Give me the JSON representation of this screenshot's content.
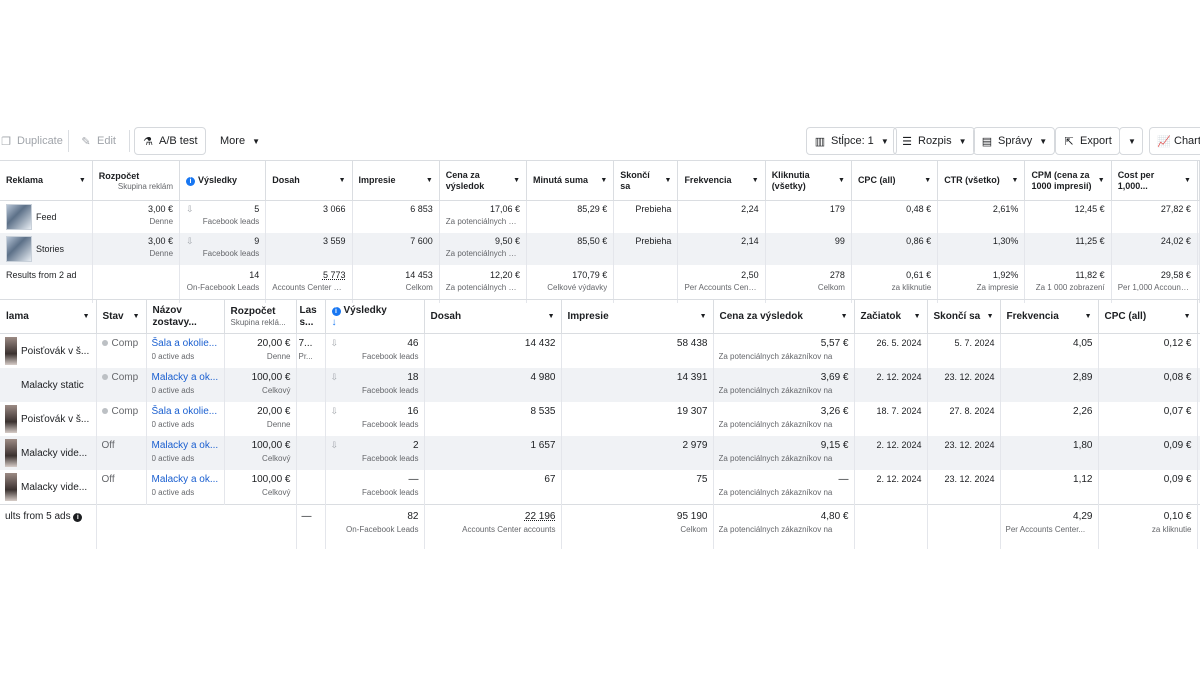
{
  "toolbar": {
    "duplicate": "Duplicate",
    "edit": "Edit",
    "ab_test": "A/B test",
    "more": "More",
    "columns": "Stĺpce: 1",
    "breakdown": "Rozpis",
    "reports": "Správy",
    "export": "Export",
    "charts": "Charts"
  },
  "top_table": {
    "headers": {
      "ad": "Reklama",
      "budget": "Rozpočet",
      "budget_sub": "Skupina reklám",
      "results": "Výsledky",
      "reach": "Dosah",
      "impressions": "Impresie",
      "cost_per_result": "Cena za výsledok",
      "amount_spent": "Minutá suma",
      "ends": "Skončí sa",
      "frequency": "Frekvencia",
      "clicks": "Kliknutia (všetky)",
      "cpc": "CPC (all)",
      "ctr": "CTR (všetko)",
      "cpm": "CPM (cena za 1000 impresií)",
      "cost_per": "Cost per 1,000..."
    },
    "rows": [
      {
        "name": "Feed",
        "budget": "3,00 €",
        "budget_sub": "Denne",
        "results": "5",
        "results_sub": "Facebook leads",
        "reach": "3 066",
        "impressions": "6 853",
        "cost_per_result": "17,06 €",
        "cost_sub": "Za potenciálnych zá...",
        "spent": "85,29 €",
        "ends": "Prebieha",
        "frequency": "2,24",
        "clicks": "179",
        "cpc": "0,48 €",
        "ctr": "2,61%",
        "cpm": "12,45 €",
        "cost_per": "27,82 €"
      },
      {
        "name": "Stories",
        "budget": "3,00 €",
        "budget_sub": "Denne",
        "results": "9",
        "results_sub": "Facebook leads",
        "reach": "3 559",
        "impressions": "7 600",
        "cost_per_result": "9,50 €",
        "cost_sub": "Za potenciálnych zá...",
        "spent": "85,50 €",
        "ends": "Prebieha",
        "frequency": "2,14",
        "clicks": "99",
        "cpc": "0,86 €",
        "ctr": "1,30%",
        "cpm": "11,25 €",
        "cost_per": "24,02 €"
      }
    ],
    "total": {
      "label": "Results from 2 ad",
      "results": "14",
      "results_sub": "On-Facebook Leads",
      "reach": "5 773",
      "reach_sub": "Accounts Center acc...",
      "impressions": "14 453",
      "impressions_sub": "Celkom",
      "cost_per_result": "12,20 €",
      "cost_sub": "Za potenciálnych zá...",
      "spent": "170,79 €",
      "spent_sub": "Celkové výdavky",
      "frequency": "2,50",
      "frequency_sub": "Per Accounts Center...",
      "clicks": "278",
      "clicks_sub": "Celkom",
      "cpc": "0,61 €",
      "cpc_sub": "za kliknutie",
      "ctr": "1,92%",
      "ctr_sub": "Za impresie",
      "cpm": "11,82 €",
      "cpm_sub": "Za 1 000 zobrazení",
      "cost_per": "29,58 €",
      "cost_per_sub": "Per 1,000 Accounts..."
    }
  },
  "bottom_table": {
    "headers": {
      "ad": "lama",
      "status": "Stav",
      "adset": "Názov zostavy...",
      "budget": "Rozpočet",
      "budget_sub": "Skupina reklá...",
      "last": "Las s...",
      "results": "Výsledky",
      "sort_arrow": "↓",
      "reach": "Dosah",
      "impressions": "Impresie",
      "cost_per_result": "Cena za výsledok",
      "start": "Začiatok",
      "ends": "Skončí sa",
      "frequency": "Frekvencia",
      "cpc": "CPC (all)"
    },
    "rows": [
      {
        "name": "Poisťovák v š...",
        "status": "Comp",
        "adset": "Šala a okolie...",
        "adset_sub": "0 active ads",
        "budget": "20,00 €",
        "budget_sub": "Denne",
        "last": "7...",
        "last_sub": "Pr...",
        "results": "46",
        "results_sub": "Facebook leads",
        "reach": "14 432",
        "impressions": "58 438",
        "cost_per_result": "5,57 €",
        "cost_sub": "Za potenciálnych zákazníkov na",
        "start": "26. 5. 2024",
        "ends": "5. 7. 2024",
        "frequency": "4,05",
        "cpc": "0,12 €"
      },
      {
        "name": "Malacky static",
        "status": "Comp",
        "adset": "Malacky a ok...",
        "adset_sub": "0 active ads",
        "budget": "100,00 €",
        "budget_sub": "Celkový",
        "last": "",
        "last_sub": "",
        "results": "18",
        "results_sub": "Facebook leads",
        "reach": "4 980",
        "impressions": "14 391",
        "cost_per_result": "3,69 €",
        "cost_sub": "Za potenciálnych zákazníkov na",
        "start": "2. 12. 2024",
        "ends": "23. 12. 2024",
        "frequency": "2,89",
        "cpc": "0,08 €"
      },
      {
        "name": "Poisťovák v š...",
        "status": "Comp",
        "adset": "Šala a okolie...",
        "adset_sub": "0 active ads",
        "budget": "20,00 €",
        "budget_sub": "Denne",
        "last": "",
        "last_sub": "",
        "results": "16",
        "results_sub": "Facebook leads",
        "reach": "8 535",
        "impressions": "19 307",
        "cost_per_result": "3,26 €",
        "cost_sub": "Za potenciálnych zákazníkov na",
        "start": "18. 7. 2024",
        "ends": "27. 8. 2024",
        "frequency": "2,26",
        "cpc": "0,07 €"
      },
      {
        "name": "Malacky vide...",
        "status": "Off",
        "adset": "Malacky a ok...",
        "adset_sub": "0 active ads",
        "budget": "100,00 €",
        "budget_sub": "Celkový",
        "last": "",
        "last_sub": "",
        "results": "2",
        "results_sub": "Facebook leads",
        "reach": "1 657",
        "impressions": "2 979",
        "cost_per_result": "9,15 €",
        "cost_sub": "Za potenciálnych zákazníkov na",
        "start": "2. 12. 2024",
        "ends": "23. 12. 2024",
        "frequency": "1,80",
        "cpc": "0,09 €"
      },
      {
        "name": "Malacky vide...",
        "status": "Off",
        "adset": "Malacky a ok...",
        "adset_sub": "0 active ads",
        "budget": "100,00 €",
        "budget_sub": "Celkový",
        "last": "",
        "last_sub": "",
        "results": "—",
        "results_sub": "Facebook leads",
        "reach": "67",
        "impressions": "75",
        "cost_per_result": "—",
        "cost_sub": "Za potenciálnych zákazníkov na",
        "start": "2. 12. 2024",
        "ends": "23. 12. 2024",
        "frequency": "1,12",
        "cpc": "0,09 €"
      }
    ],
    "total": {
      "label": "ults from 5 ads",
      "last": "—",
      "results": "82",
      "results_sub": "On-Facebook Leads",
      "reach": "22 196",
      "reach_sub": "Accounts Center accounts",
      "impressions": "95 190",
      "impressions_sub": "Celkom",
      "cost_per_result": "4,80 €",
      "cost_sub": "Za potenciálnych zákazníkov na",
      "frequency": "4,29",
      "frequency_sub": "Per Accounts Center...",
      "cpc": "0,10 €",
      "cpc_sub": "za kliknutie"
    }
  },
  "colors": {
    "link": "#1a5fd0",
    "info_icon": "#1877f2",
    "row_shade": "#f0f2f5",
    "muted": "#65676b"
  }
}
